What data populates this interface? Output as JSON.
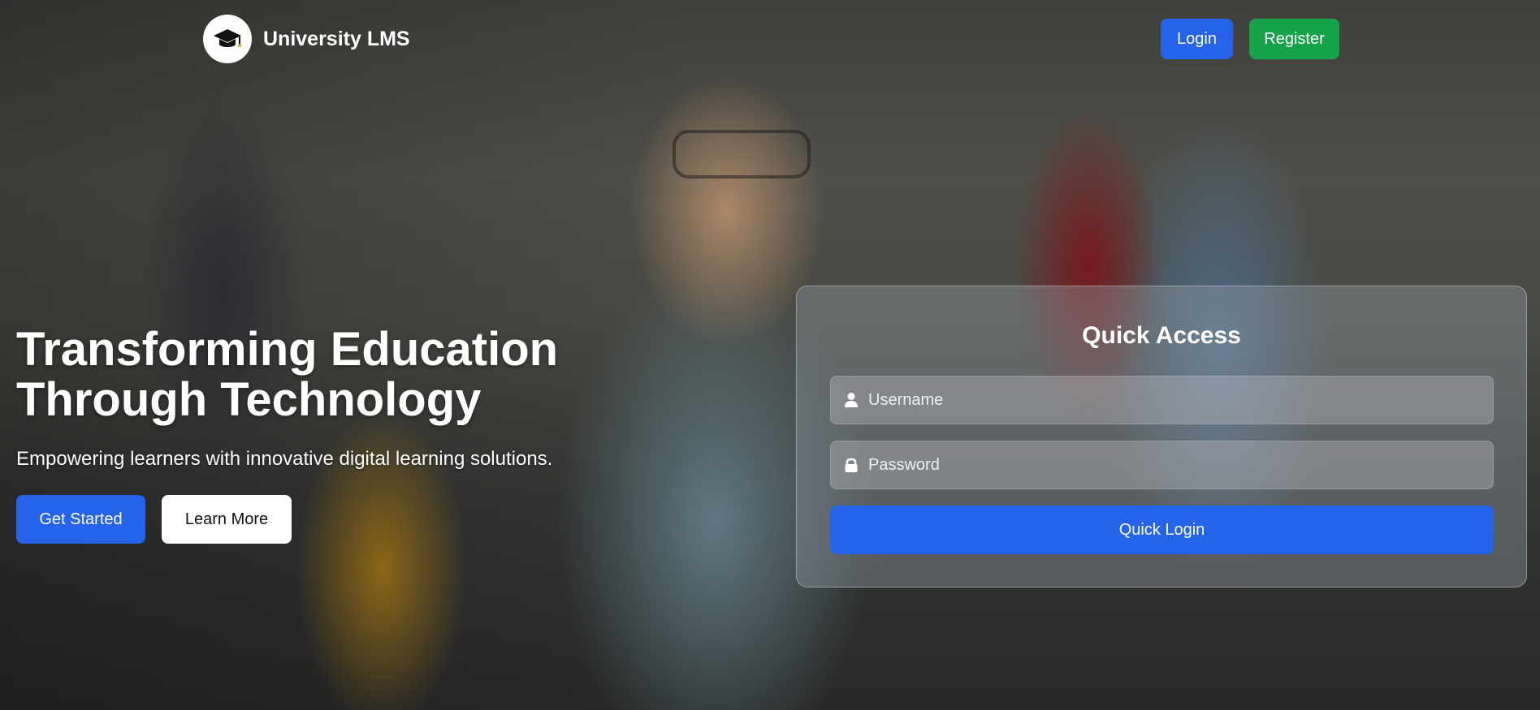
{
  "brand": {
    "name": "University LMS",
    "logo_icon": "graduation-cap-icon"
  },
  "nav": {
    "login_label": "Login",
    "register_label": "Register"
  },
  "hero": {
    "title_line1": "Transforming Education",
    "title_line2": "Through Technology",
    "subtitle": "Empowering learners with innovative digital learning solutions.",
    "primary_cta": "Get Started",
    "secondary_cta": "Learn More"
  },
  "quick_access": {
    "title": "Quick Access",
    "username_placeholder": "Username",
    "password_placeholder": "Password",
    "submit_label": "Quick Login"
  },
  "colors": {
    "primary": "#2563eb",
    "success": "#16a34a"
  }
}
